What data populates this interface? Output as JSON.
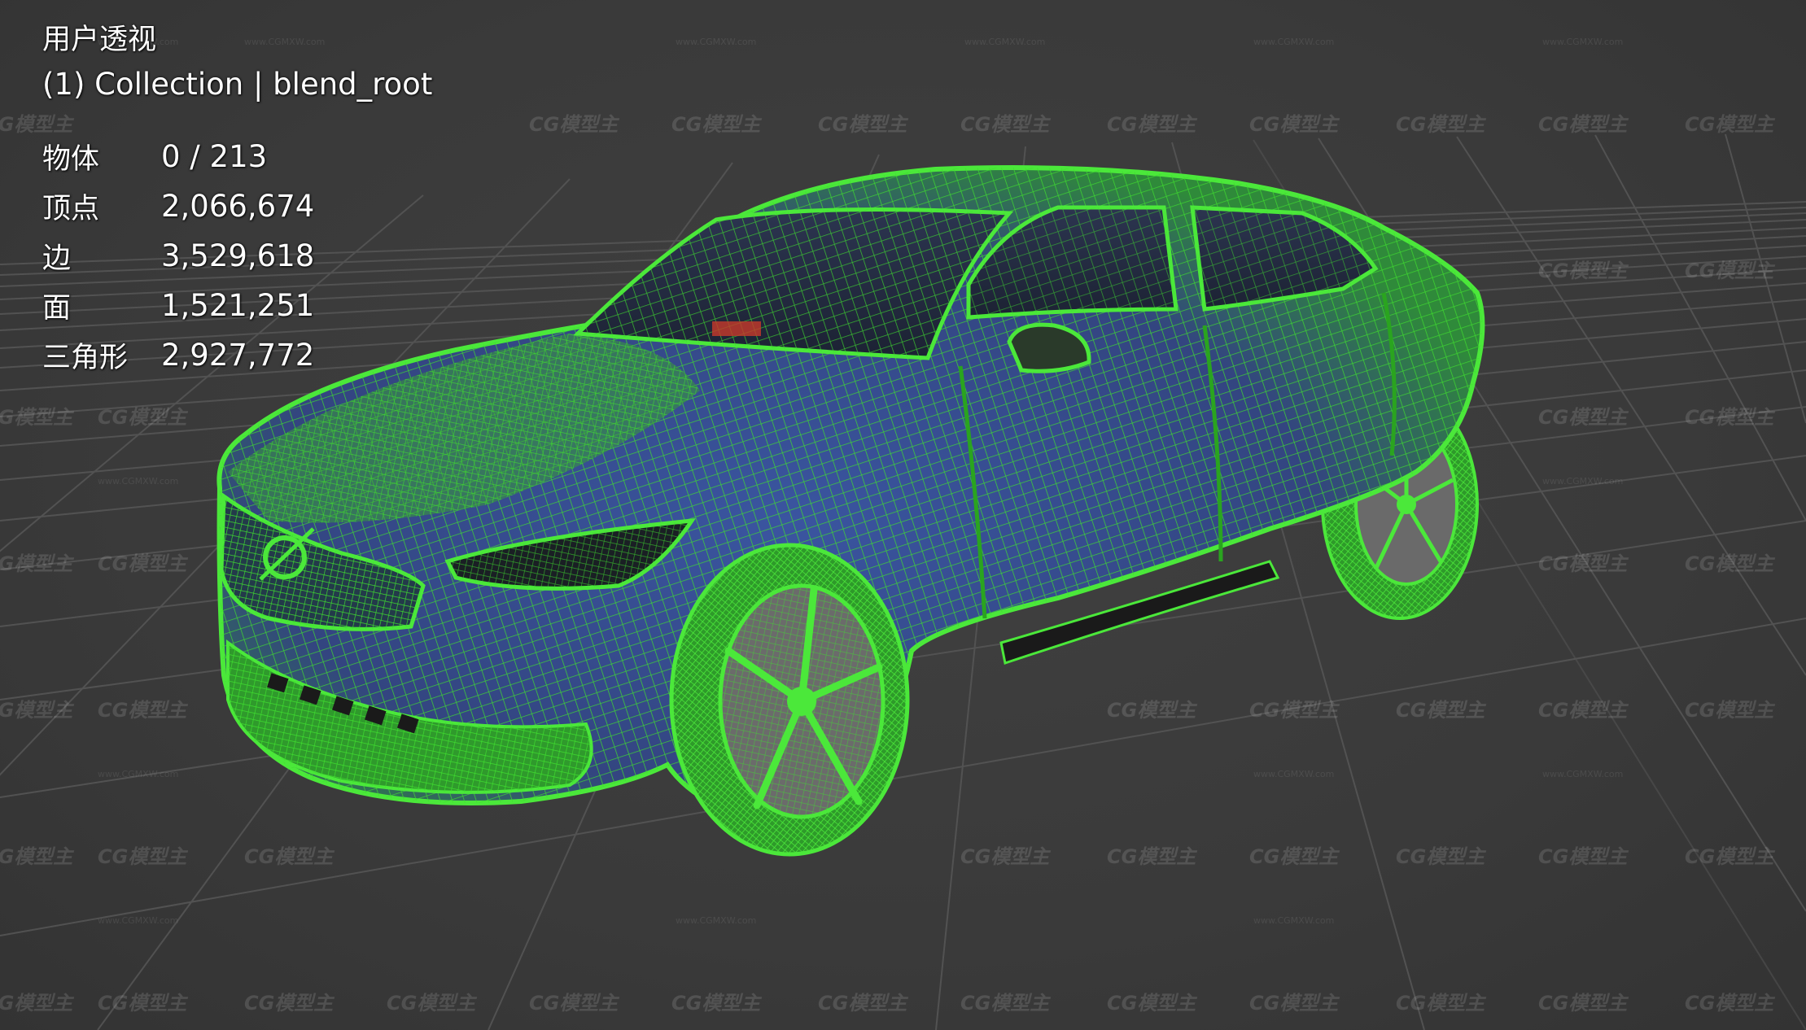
{
  "viewport": {
    "view_name": "用户透视",
    "collection_label": "(1) Collection | blend_root"
  },
  "stats": [
    {
      "label": "物体",
      "value": "0 / 213"
    },
    {
      "label": "顶点",
      "value": "2,066,674"
    },
    {
      "label": "边",
      "value": "3,529,618"
    },
    {
      "label": "面",
      "value": "1,521,251"
    },
    {
      "label": "三角形",
      "value": "2,927,772"
    }
  ],
  "watermark": {
    "text": "CG模型主",
    "sub": "www.CGMXW.com"
  },
  "colors": {
    "background": "#3b3b3b",
    "grid": "#555555",
    "wireframe": "#39d62a",
    "body_fill": "#3a4f8c",
    "text": "#ffffff"
  },
  "icons": {
    "model": "car-wireframe-model"
  }
}
